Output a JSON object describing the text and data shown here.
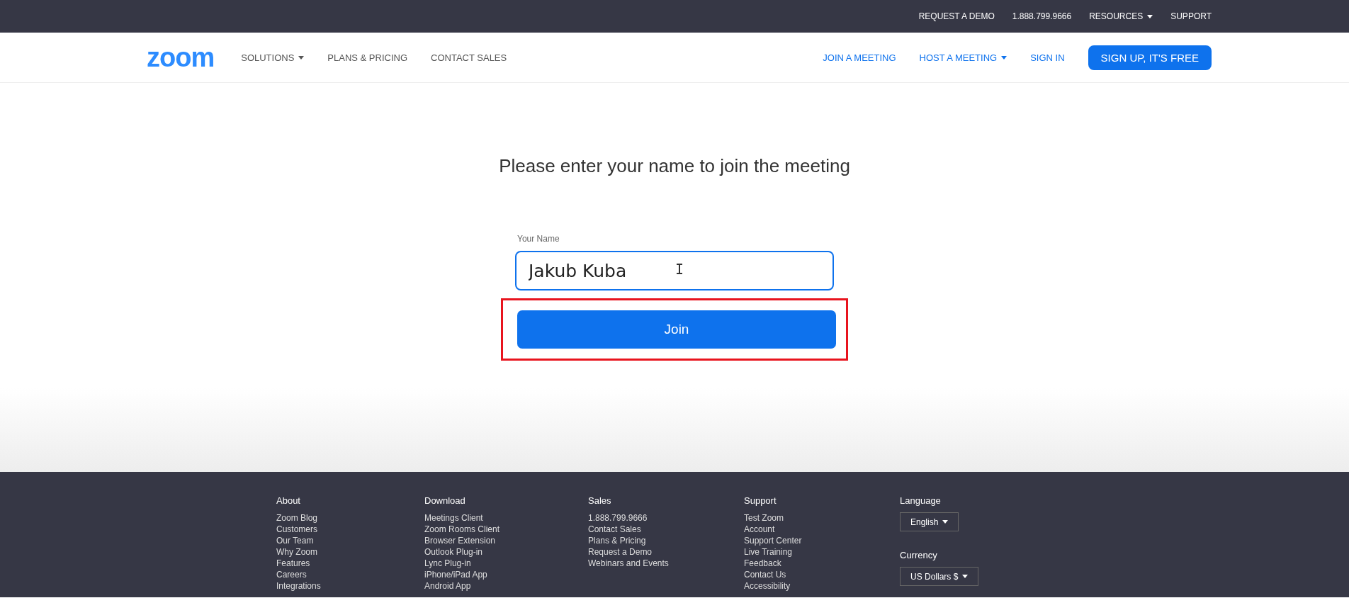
{
  "top_bar": {
    "links": [
      {
        "label": "REQUEST A DEMO",
        "dropdown": false
      },
      {
        "label": "1.888.799.9666",
        "dropdown": false
      },
      {
        "label": "RESOURCES",
        "dropdown": true
      },
      {
        "label": "SUPPORT",
        "dropdown": false
      }
    ]
  },
  "header": {
    "logo": "zoom",
    "nav": [
      {
        "label": "SOLUTIONS",
        "dropdown": true
      },
      {
        "label": "PLANS & PRICING",
        "dropdown": false
      },
      {
        "label": "CONTACT SALES",
        "dropdown": false
      }
    ],
    "right_nav": [
      {
        "label": "JOIN A MEETING",
        "dropdown": false
      },
      {
        "label": "HOST A MEETING",
        "dropdown": true
      },
      {
        "label": "SIGN IN",
        "dropdown": false
      }
    ],
    "signup_button": "SIGN UP, IT'S FREE"
  },
  "main": {
    "heading": "Please enter your name to join the meeting",
    "name_field": {
      "label": "Your Name",
      "value": "Jakub Kuba"
    },
    "join_button": {
      "label": "Join",
      "highlighted": true
    }
  },
  "footer": {
    "columns": [
      {
        "heading": "About",
        "links": [
          "Zoom Blog",
          "Customers",
          "Our Team",
          "Why Zoom",
          "Features",
          "Careers",
          "Integrations"
        ]
      },
      {
        "heading": "Download",
        "links": [
          "Meetings Client",
          "Zoom Rooms Client",
          "Browser Extension",
          "Outlook Plug-in",
          "Lync Plug-in",
          "iPhone/iPad App",
          "Android App"
        ]
      },
      {
        "heading": "Sales",
        "links": [
          "1.888.799.9666",
          "Contact Sales",
          "Plans & Pricing",
          "Request a Demo",
          "Webinars and Events"
        ]
      },
      {
        "heading": "Support",
        "links": [
          "Test Zoom",
          "Account",
          "Support Center",
          "Live Training",
          "Feedback",
          "Contact Us",
          "Accessibility"
        ]
      }
    ],
    "language": {
      "heading": "Language",
      "value": "English"
    },
    "currency": {
      "heading": "Currency",
      "value": "US Dollars $"
    }
  }
}
